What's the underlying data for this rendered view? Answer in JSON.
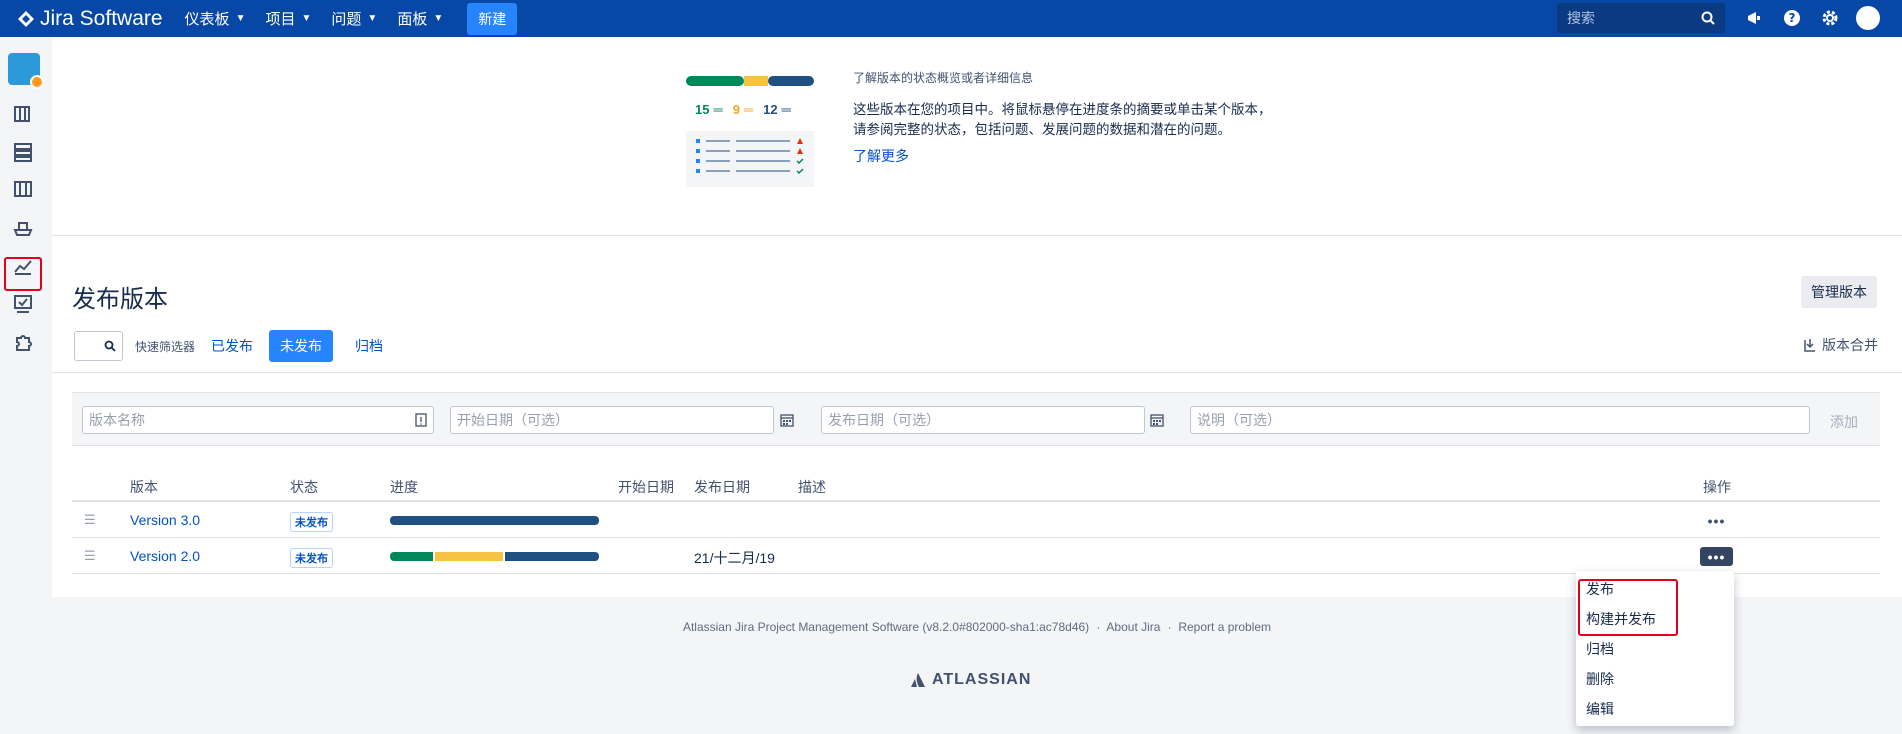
{
  "app": {
    "name": "Jira Software"
  },
  "nav": {
    "items": [
      {
        "label": "仪表板"
      },
      {
        "label": "项目"
      },
      {
        "label": "问题"
      },
      {
        "label": "面板"
      }
    ],
    "create_label": "新建",
    "search_placeholder": "搜索"
  },
  "illustration": {
    "counts": {
      "done": "15",
      "in_progress": "9",
      "todo": "12"
    },
    "heading": "了解版本的状态概览或者详细信息",
    "description": "这些版本在您的项目中。将鼠标悬停在进度条的摘要或单击某个版本，请参阅完整的状态，包括问题、发展问题的数据和潜在的问题。",
    "learn_more": "了解更多"
  },
  "page": {
    "title": "发布版本",
    "manage_label": "管理版本",
    "quick_filter_label": "快速筛选器",
    "tabs": [
      {
        "label": "已发布",
        "active": false
      },
      {
        "label": "未发布",
        "active": true
      },
      {
        "label": "归档",
        "active": false
      }
    ],
    "merge_label": "版本合并"
  },
  "form": {
    "name_placeholder": "版本名称",
    "start_placeholder": "开始日期（可选）",
    "release_placeholder": "发布日期（可选）",
    "desc_placeholder": "说明（可选）",
    "add_label": "添加"
  },
  "table": {
    "headers": {
      "version": "版本",
      "status": "状态",
      "progress": "进度",
      "start": "开始日期",
      "release": "发布日期",
      "desc": "描述",
      "actions": "操作"
    },
    "rows": [
      {
        "name": "Version 3.0",
        "status": "未发布",
        "release_date": "",
        "progress": {
          "done": 0,
          "in_progress": 0,
          "todo": 1
        }
      },
      {
        "name": "Version 2.0",
        "status": "未发布",
        "release_date": "21/十二月/19",
        "progress": {
          "done": 0.21,
          "in_progress": 0.33,
          "todo": 0.46
        }
      }
    ]
  },
  "dropdown": {
    "items": [
      "发布",
      "构建并发布",
      "归档",
      "删除",
      "编辑"
    ]
  },
  "footer": {
    "text": "Atlassian Jira Project Management Software (v8.2.0#802000-sha1:ac78d46)",
    "about": "About Jira",
    "report": "Report a problem",
    "brand": "ATLASSIAN"
  },
  "colors": {
    "done": "#00875a",
    "in_progress": "#f6c342",
    "todo": "#205081",
    "nav_bg": "#0747a6",
    "primary": "#2684ff"
  }
}
